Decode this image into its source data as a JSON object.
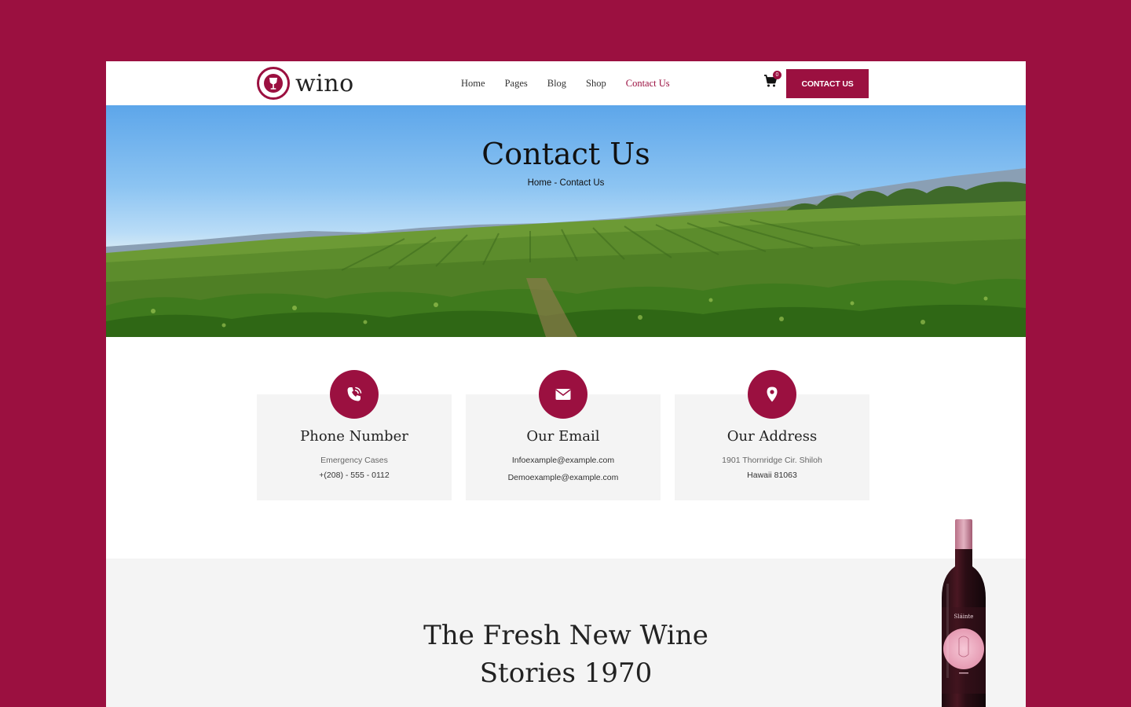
{
  "brand": {
    "name": "wino",
    "accent_color": "#9b1040",
    "logo_icon": "wine-glass-icon"
  },
  "nav": {
    "items": [
      {
        "label": "Home",
        "active": false
      },
      {
        "label": "Pages",
        "active": false
      },
      {
        "label": "Blog",
        "active": false
      },
      {
        "label": "Shop",
        "active": false
      },
      {
        "label": "Contact Us",
        "active": true
      }
    ]
  },
  "cart": {
    "icon": "cart-icon",
    "count": "0"
  },
  "header_cta": {
    "label": "CONTACT US"
  },
  "hero": {
    "title": "Contact Us",
    "breadcrumb": {
      "home": "Home",
      "separator": " - ",
      "current": "Contact Us"
    }
  },
  "contact_cards": [
    {
      "icon": "phone-icon",
      "title": "Phone Number",
      "line1": "Emergency Cases",
      "line2": "+(208) - 555 - 0112"
    },
    {
      "icon": "envelope-icon",
      "title": "Our Email",
      "line1": "Infoexample@example.com",
      "line2": "Demoexample@example.com"
    },
    {
      "icon": "location-pin-icon",
      "title": "Our Address",
      "line1": "1901 Thornridge Cir. Shiloh",
      "line2": "Hawaii 81063"
    }
  ],
  "story": {
    "title_line1": "The Fresh New Wine",
    "title_line2": "Stories 1970",
    "bottle_label": "Sláinte"
  }
}
